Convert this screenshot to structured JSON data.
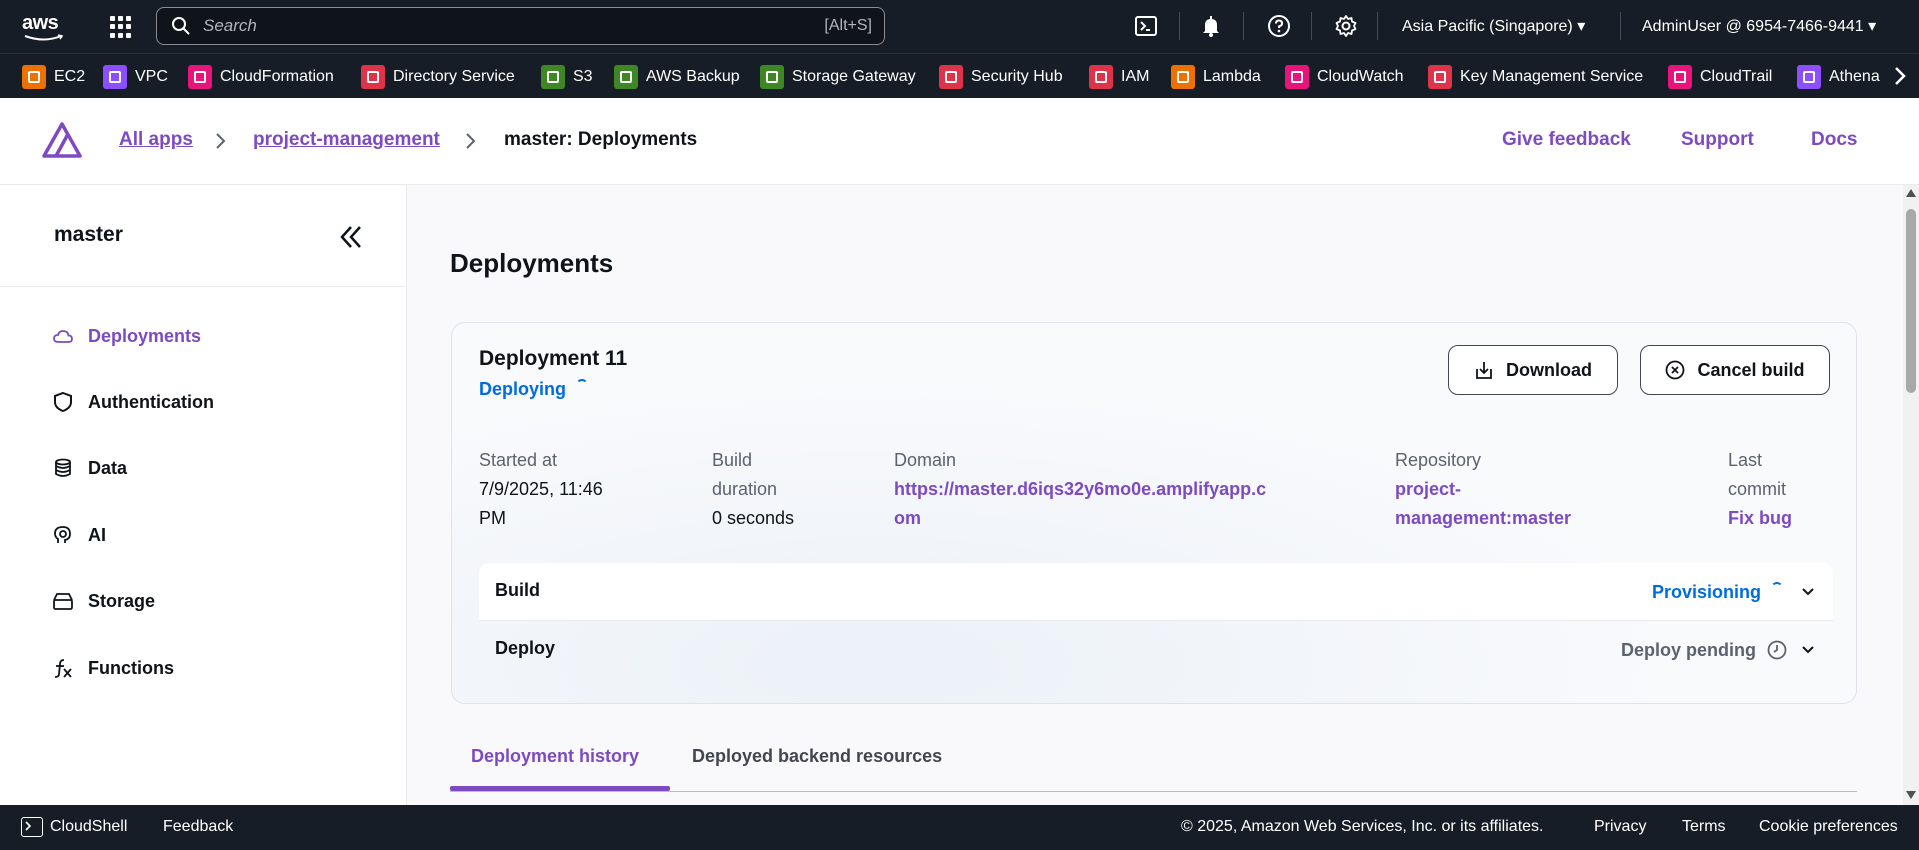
{
  "topnav": {
    "logo_text": "aws",
    "search_placeholder": "Search",
    "search_shortcut": "[Alt+S]",
    "region": "Asia Pacific (Singapore)",
    "account": "AdminUser @ 6954-7466-9441"
  },
  "services": [
    {
      "label": "EC2",
      "color": "#ed7100"
    },
    {
      "label": "VPC",
      "color": "#8c4fff"
    },
    {
      "label": "CloudFormation",
      "color": "#e7157b"
    },
    {
      "label": "Directory Service",
      "color": "#dd344c"
    },
    {
      "label": "S3",
      "color": "#3f8624"
    },
    {
      "label": "AWS Backup",
      "color": "#3f8624"
    },
    {
      "label": "Storage Gateway",
      "color": "#3f8624"
    },
    {
      "label": "Security Hub",
      "color": "#dd344c"
    },
    {
      "label": "IAM",
      "color": "#dd344c"
    },
    {
      "label": "Lambda",
      "color": "#ed7100"
    },
    {
      "label": "CloudWatch",
      "color": "#e7157b"
    },
    {
      "label": "Key Management Service",
      "color": "#dd344c"
    },
    {
      "label": "CloudTrail",
      "color": "#e7157b"
    },
    {
      "label": "Athena",
      "color": "#8c4fff"
    }
  ],
  "header": {
    "breadcrumb": [
      "All apps",
      "project-management",
      "master: Deployments"
    ],
    "links": [
      "Give feedback",
      "Support",
      "Docs"
    ]
  },
  "sidebar": {
    "title": "master",
    "items": [
      {
        "label": "Deployments",
        "active": true
      },
      {
        "label": "Authentication"
      },
      {
        "label": "Data"
      },
      {
        "label": "AI"
      },
      {
        "label": "Storage"
      },
      {
        "label": "Functions"
      }
    ]
  },
  "main": {
    "title": "Deployments",
    "deployment": {
      "title": "Deployment 11",
      "status": "Deploying",
      "download_label": "Download",
      "cancel_label": "Cancel build",
      "meta": {
        "started_label": "Started at",
        "started_value_1": "7/9/2025, 11:46",
        "started_value_2": "PM",
        "duration_label_1": "Build",
        "duration_label_2": "duration",
        "duration_value": "0 seconds",
        "domain_label": "Domain",
        "domain_value_1": "https://master.d6iqs32y6mo0e.amplifyapp.c",
        "domain_value_2": "om",
        "repo_label": "Repository",
        "repo_value_1": "project-",
        "repo_value_2": "management:master",
        "commit_label_1": "Last",
        "commit_label_2": "commit",
        "commit_value": "Fix bug"
      },
      "stages": [
        {
          "name": "Build",
          "status": "Provisioning"
        },
        {
          "name": "Deploy",
          "status": "Deploy pending"
        }
      ]
    },
    "tabs": [
      "Deployment history",
      "Deployed backend resources"
    ]
  },
  "footer": {
    "cloudshell": "CloudShell",
    "feedback": "Feedback",
    "copyright": "© 2025, Amazon Web Services, Inc. or its affiliates.",
    "privacy": "Privacy",
    "terms": "Terms",
    "cookies": "Cookie preferences"
  },
  "colors": {
    "nav_bg": "#161d26",
    "accent_purple": "#7d4ac2",
    "status_blue": "#006ce0"
  }
}
